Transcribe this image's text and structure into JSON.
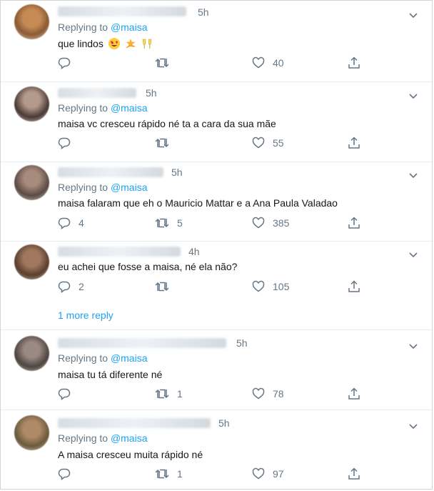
{
  "replying_prefix": "Replying to",
  "more_reply_label": "1 more reply",
  "colors": {
    "link": "#1da1f2",
    "muted": "#657786",
    "text": "#14171a",
    "divider": "#e6ecf0"
  },
  "tweets": [
    {
      "time": "5h",
      "replying_to": "@maisa",
      "text": "que lindos",
      "emojis": [
        "heart-eyes-emoji",
        "dizzy-emoji",
        "clinking-glasses-emoji"
      ],
      "replies": "",
      "retweets": "",
      "likes": "40"
    },
    {
      "time": "5h",
      "replying_to": "@maisa",
      "text": "maisa vc cresceu rápido né ta a cara da sua mãe",
      "replies": "",
      "retweets": "",
      "likes": "55"
    },
    {
      "time": "5h",
      "replying_to": "@maisa",
      "text": "maisa falaram que eh o Mauricio Mattar e a Ana Paula Valadao",
      "replies": "4",
      "retweets": "5",
      "likes": "385"
    },
    {
      "time": "4h",
      "replying_to": "",
      "text": "eu achei que fosse a maisa, né ela não?",
      "replies": "2",
      "retweets": "",
      "likes": "105"
    },
    {
      "time": "5h",
      "replying_to": "@maisa",
      "text": "maisa tu tá diferente né",
      "replies": "",
      "retweets": "1",
      "likes": "78"
    },
    {
      "time": "5h",
      "replying_to": "@maisa",
      "text": "A maisa cresceu muita rápido né",
      "replies": "",
      "retweets": "1",
      "likes": "97"
    }
  ]
}
